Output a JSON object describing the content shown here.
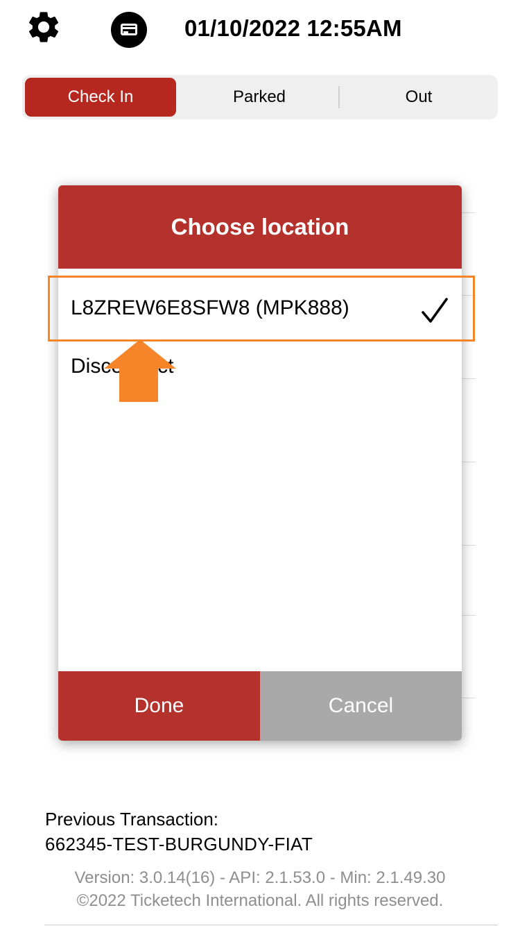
{
  "header": {
    "settings_icon": "gear-icon",
    "card_icon": "credit-card-icon",
    "datetime": "01/10/2022 12:55AM"
  },
  "tabs": [
    {
      "label": "Check In",
      "active": true
    },
    {
      "label": "Parked",
      "active": false
    },
    {
      "label": "Out",
      "active": false
    }
  ],
  "dialog": {
    "title": "Choose location",
    "options": [
      {
        "label": "L8ZREW6E8SFW8 (MPK888)",
        "selected": true
      },
      {
        "label": "Disconnect",
        "selected": false
      }
    ],
    "done_label": "Done",
    "cancel_label": "Cancel"
  },
  "footer": {
    "previous_label": "Previous Transaction:",
    "previous_value": "662345-TEST-BURGUNDY-FIAT",
    "version": "Version: 3.0.14(16) - API: 2.1.53.0 - Min: 2.1.49.30",
    "copyright": "©2022 Ticketech International. All rights reserved."
  },
  "colors": {
    "accent_red": "#b5312c",
    "tab_active_red": "#b5271f",
    "cancel_gray": "#a9a9a9",
    "annotation_orange": "#f68428"
  }
}
